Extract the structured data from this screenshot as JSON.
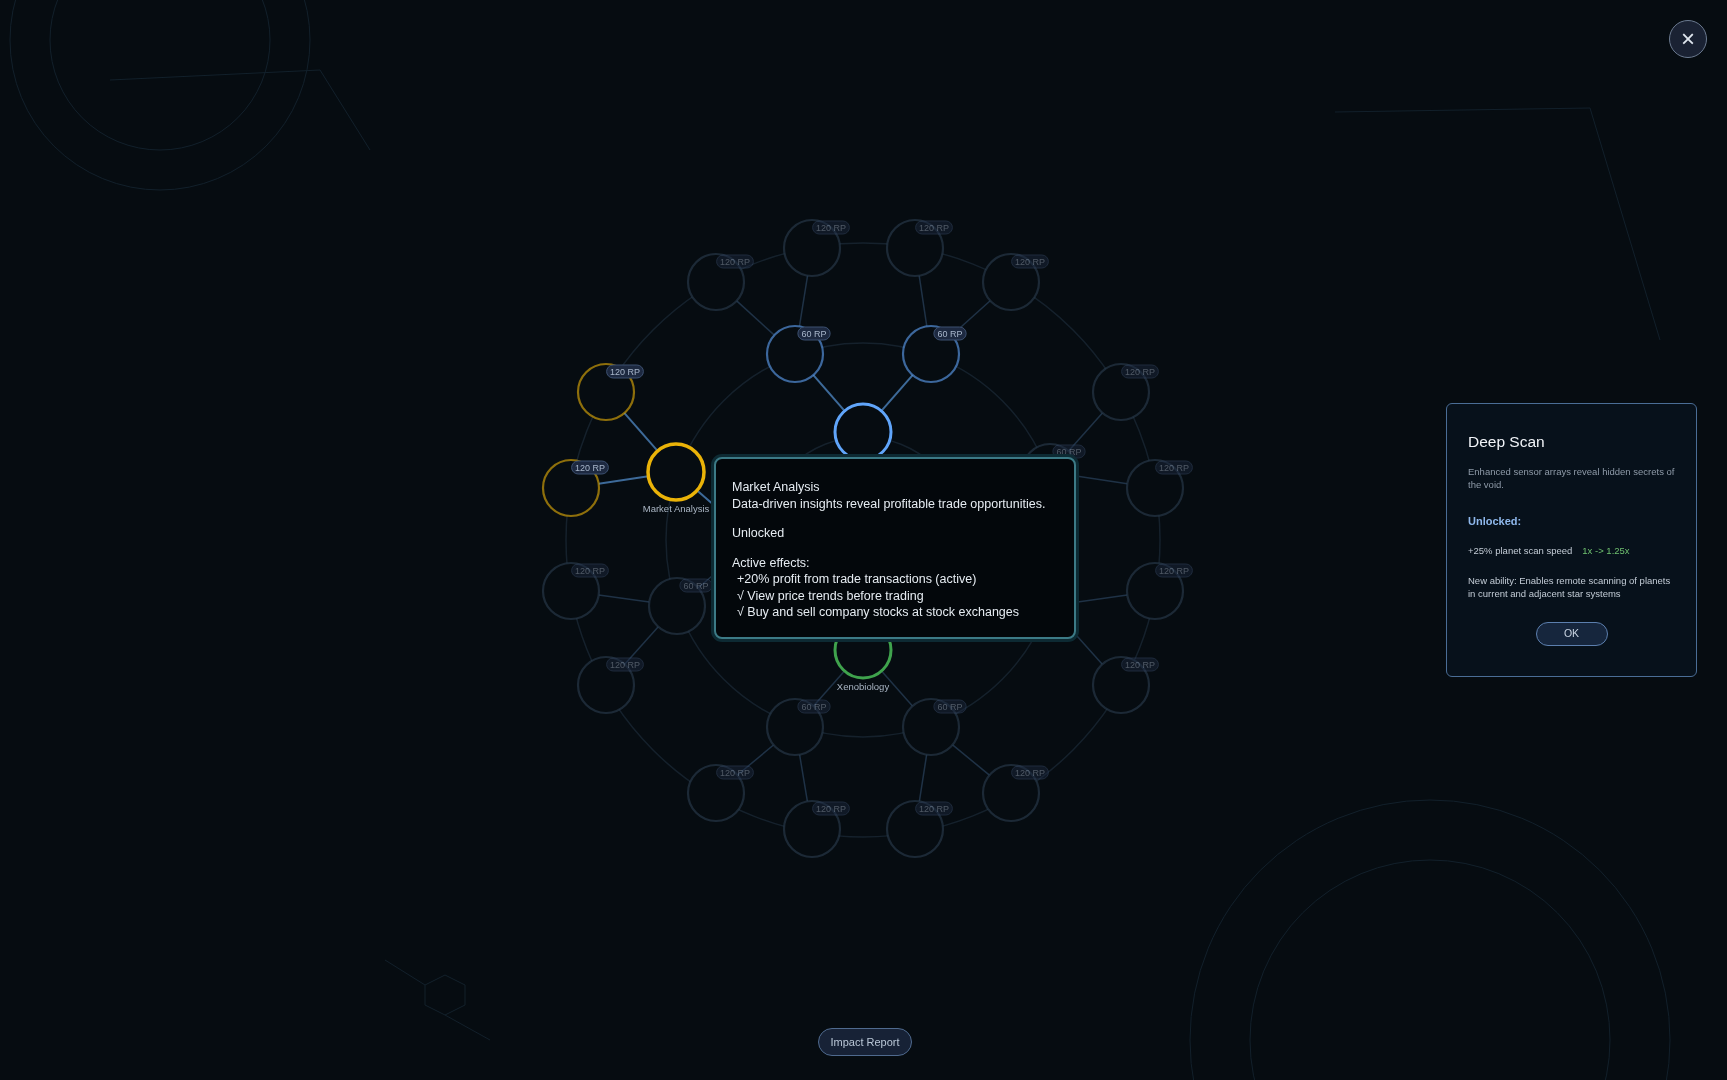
{
  "tree": {
    "branches": [
      {
        "color": "#60a5fa",
        "root": {
          "selected": false,
          "unlocked": true,
          "available": true
        },
        "children": [
          {
            "selected": false,
            "unlocked": false,
            "available": true,
            "cost": "60 RP",
            "children": [
              {
                "selected": false,
                "unlocked": false,
                "available": false,
                "cost": "120 RP"
              },
              {
                "selected": false,
                "unlocked": false,
                "available": false,
                "cost": "120 RP"
              }
            ]
          },
          {
            "selected": false,
            "unlocked": false,
            "available": true,
            "cost": "60 RP",
            "children": [
              {
                "selected": false,
                "unlocked": false,
                "available": false,
                "cost": "120 RP"
              },
              {
                "selected": false,
                "unlocked": false,
                "available": false,
                "cost": "120 RP"
              }
            ]
          }
        ]
      },
      {
        "color": "#eab308",
        "children": [
          {
            "selected": true,
            "unlocked": true,
            "available": true,
            "label": "Market Analysis",
            "children": [
              {
                "selected": false,
                "unlocked": false,
                "available": true,
                "cost": "120 RP"
              },
              {
                "selected": false,
                "unlocked": false,
                "available": true,
                "cost": "120 RP"
              }
            ]
          },
          {
            "selected": false,
            "unlocked": false,
            "available": false,
            "cost": "60 RP",
            "children": [
              {
                "selected": false,
                "unlocked": false,
                "available": false,
                "cost": "120 RP"
              },
              {
                "selected": false,
                "unlocked": false,
                "available": false,
                "cost": "120 RP"
              }
            ]
          }
        ]
      },
      {
        "children": [
          {
            "selected": false,
            "unlocked": false,
            "available": false,
            "cost": "60 RP",
            "children": [
              {
                "selected": false,
                "unlocked": false,
                "available": false,
                "cost": "120 RP"
              },
              {
                "selected": false,
                "unlocked": false,
                "available": false,
                "cost": "120 RP"
              }
            ]
          },
          {
            "children": [
              {
                "selected": false,
                "unlocked": false,
                "available": false,
                "cost": "120 RP"
              },
              {
                "selected": false,
                "unlocked": false,
                "available": false,
                "cost": "120 RP"
              }
            ]
          }
        ]
      },
      {
        "color": "#3fa34d",
        "root": {
          "selected": false,
          "unlocked": true,
          "available": true,
          "label": "Xenobiology"
        },
        "children": [
          {
            "selected": false,
            "unlocked": false,
            "available": false,
            "cost": "60 RP",
            "children": [
              {
                "selected": false,
                "unlocked": false,
                "available": false,
                "cost": "120 RP"
              },
              {
                "selected": false,
                "unlocked": false,
                "available": false,
                "cost": "120 RP"
              }
            ]
          },
          {
            "selected": false,
            "unlocked": false,
            "available": false,
            "cost": "60 RP",
            "children": [
              {
                "selected": false,
                "unlocked": false,
                "available": false,
                "cost": "120 RP"
              },
              {
                "selected": false,
                "unlocked": false,
                "available": false,
                "cost": "120 RP"
              }
            ]
          }
        ]
      }
    ]
  },
  "tooltip": {
    "title": "Market Analysis",
    "description": "Data-driven insights reveal profitable trade opportunities.",
    "status": "Unlocked",
    "effects_heading": "Active effects:",
    "effects": [
      "+20% profit from trade transactions (active)",
      "√ View price trends before trading",
      "√ Buy and sell company stocks at stock exchanges"
    ]
  },
  "panel": {
    "title": "Deep Scan",
    "description": "Enhanced sensor arrays reveal hidden secrets of the void.",
    "section": "Unlocked:",
    "stats": [
      {
        "text": "+25% planet scan speed",
        "change": "1x -> 1.25x"
      }
    ],
    "ability": "New ability: Enables remote scanning of planets in current and adjacent star systems",
    "button": "OK"
  },
  "close_button": "×",
  "footer_button": "Impact Report"
}
